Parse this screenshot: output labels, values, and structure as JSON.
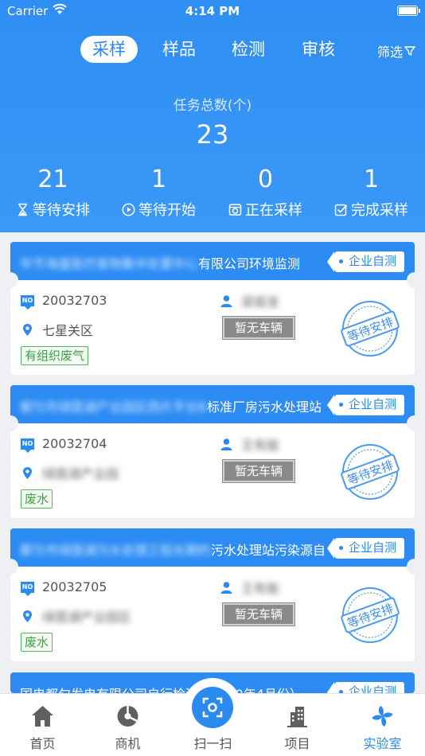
{
  "status_bar": {
    "carrier": "Carrier",
    "time": "4:14 PM"
  },
  "tabs": [
    {
      "label": "采样"
    },
    {
      "label": "样品"
    },
    {
      "label": "检测"
    },
    {
      "label": "审核"
    }
  ],
  "filter_label": "筛选",
  "summary": {
    "label": "任务总数(个)",
    "total": "23"
  },
  "stats": [
    {
      "value": "21",
      "label": "等待安排"
    },
    {
      "value": "1",
      "label": "等待开始"
    },
    {
      "value": "0",
      "label": "正在采样"
    },
    {
      "value": "1",
      "label": "完成采样"
    }
  ],
  "tasks": [
    {
      "title_blurred": "毕节海盛医疗废物集中处置中心",
      "title": "有限公司环境监测",
      "tag": "企业自测",
      "number": "20032703",
      "person": "梁振发",
      "location": "七星关区",
      "vehicle": "暂无车辆",
      "type": "有组织废气",
      "status": "等待安排",
      "location_blurred": false
    },
    {
      "title_blurred": "都匀市绿茵湖产业园区西片平台B",
      "title": "标准厂房污水处理站",
      "tag": "企业自测",
      "number": "20032704",
      "person": "王有能",
      "location": "绿茵湖产业园",
      "vehicle": "暂无车辆",
      "type": "废水",
      "status": "等待安排",
      "location_blurred": true
    },
    {
      "title_blurred": "都匀市绿茵湖污水处理工程长期的",
      "title": "污水处理站污染源自",
      "tag": "企业自测",
      "number": "20032705",
      "person": "王有能",
      "location": "绿茵湖产业园区",
      "vehicle": "暂无车辆",
      "type": "废水",
      "status": "等待安排",
      "location_blurred": true
    },
    {
      "title": "国电都匀发电有限公司自行检测（2020年4月份）",
      "tag": "企业自测"
    }
  ],
  "tabbar": [
    {
      "label": "首页",
      "icon": "home-icon"
    },
    {
      "label": "商机",
      "icon": "pie-icon"
    },
    {
      "label": "扫一扫",
      "icon": "scan-icon"
    },
    {
      "label": "项目",
      "icon": "building-icon"
    },
    {
      "label": "实验室",
      "icon": "pinwheel-icon"
    }
  ],
  "colors": {
    "primary": "#2a8af0",
    "header": "#2e8ef3",
    "green": "#3aa441",
    "gray_button": "#8a8a8a"
  }
}
